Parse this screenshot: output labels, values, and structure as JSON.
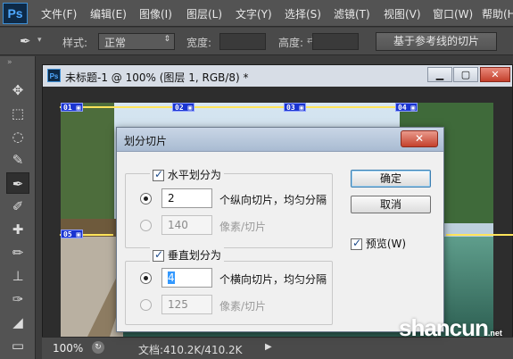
{
  "app": {
    "logo": "Ps",
    "menu": [
      "文件(F)",
      "编辑(E)",
      "图像(I)",
      "图层(L)",
      "文字(Y)",
      "选择(S)",
      "滤镜(T)",
      "视图(V)",
      "窗口(W)",
      "帮助(H)"
    ]
  },
  "options": {
    "style_label": "样式:",
    "style_value": "正常",
    "width_label": "宽度:",
    "height_label": "高度:",
    "guides_button": "基于参考线的切片"
  },
  "document": {
    "title": "未标题-1 @ 100% (图层 1, RGB/8) *",
    "min": "▁",
    "max": "▢",
    "close": "✕",
    "slices": [
      "01",
      "02",
      "03",
      "04",
      "05"
    ]
  },
  "status": {
    "zoom": "100%",
    "doc_size": "文档:410.2K/410.2K"
  },
  "dialog": {
    "title": "划分切片",
    "horizontal": {
      "label": "水平划分为",
      "checked": true,
      "count": "2",
      "count_suffix": "个纵向切片，均匀分隔",
      "pixels": "140",
      "pixels_suffix": "像素/切片"
    },
    "vertical": {
      "label": "垂直划分为",
      "checked": true,
      "count": "4",
      "count_suffix": "个横向切片，均匀分隔",
      "pixels": "125",
      "pixels_suffix": "像素/切片"
    },
    "ok": "确定",
    "cancel": "取消",
    "preview": "预览(W)",
    "preview_checked": true
  },
  "watermark": {
    "text": "shancun",
    "suffix": ".net"
  },
  "colors": {
    "slice_tag": "#1a34d0",
    "slice_line": "#ffe45a",
    "dialog_bg": "#f0f0f0"
  }
}
